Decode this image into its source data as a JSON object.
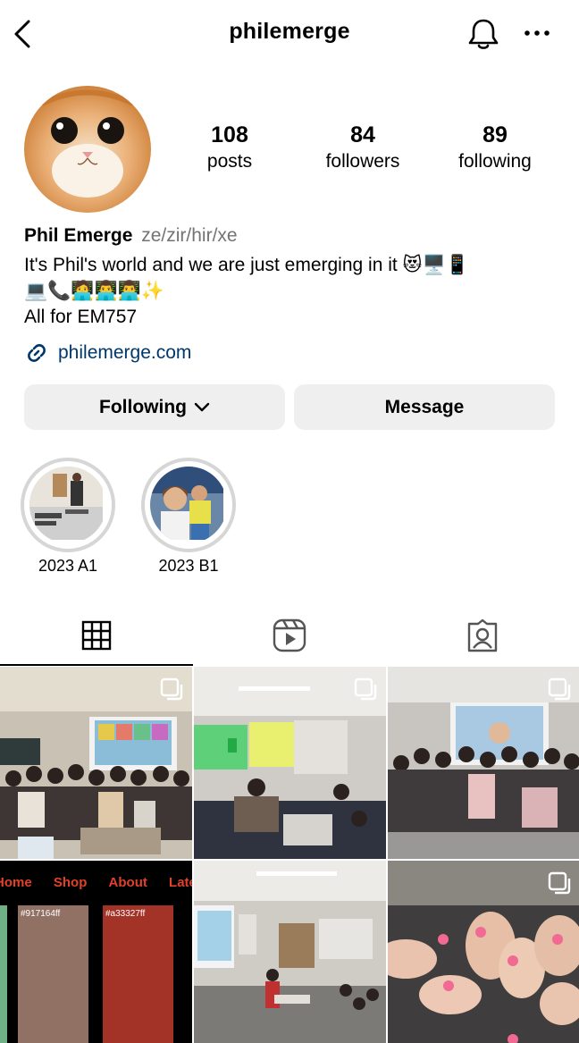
{
  "header": {
    "username": "philemerge",
    "back_icon": "back-arrow-icon",
    "bell_icon": "bell-icon",
    "more_icon": "more-dots-icon"
  },
  "profile": {
    "stats": [
      {
        "value": "108",
        "label": "posts"
      },
      {
        "value": "84",
        "label": "followers"
      },
      {
        "value": "89",
        "label": "following"
      }
    ],
    "display_name": "Phil Emerge",
    "pronouns": "ze/zir/hir/xe",
    "bio_line1_text": "It's Phil's world and we are just emerging in it",
    "bio_line1_emojis": "😻🖥️📱",
    "bio_line2_emojis": "💻📞🧑‍💻👨‍💻👨‍💻✨",
    "bio_line3": "All for EM757",
    "link": "philemerge.com"
  },
  "actions": {
    "following_label": "Following",
    "message_label": "Message"
  },
  "highlights": [
    {
      "label": "2023 A1"
    },
    {
      "label": "2023 B1"
    }
  ],
  "tabs": [
    {
      "name": "posts-grid",
      "icon": "grid-icon"
    },
    {
      "name": "reels",
      "icon": "reels-icon"
    },
    {
      "name": "tagged",
      "icon": "tagged-icon"
    }
  ],
  "posts": [
    {
      "kind": "photo",
      "multi": true
    },
    {
      "kind": "photo",
      "multi": true
    },
    {
      "kind": "photo",
      "multi": true
    },
    {
      "kind": "web-screenshot",
      "multi": false,
      "nav": [
        "Home",
        "Shop",
        "About",
        "Lates"
      ],
      "swatches": [
        "#917164ff",
        "#a33327ff"
      ]
    },
    {
      "kind": "photo",
      "multi": false
    },
    {
      "kind": "photo",
      "multi": true
    }
  ],
  "colors": {
    "link": "#00376b",
    "button_bg": "#efefef",
    "muted": "#737373",
    "swatch_1": "#917164",
    "swatch_2": "#a33327",
    "nav_text": "#e0412a"
  }
}
